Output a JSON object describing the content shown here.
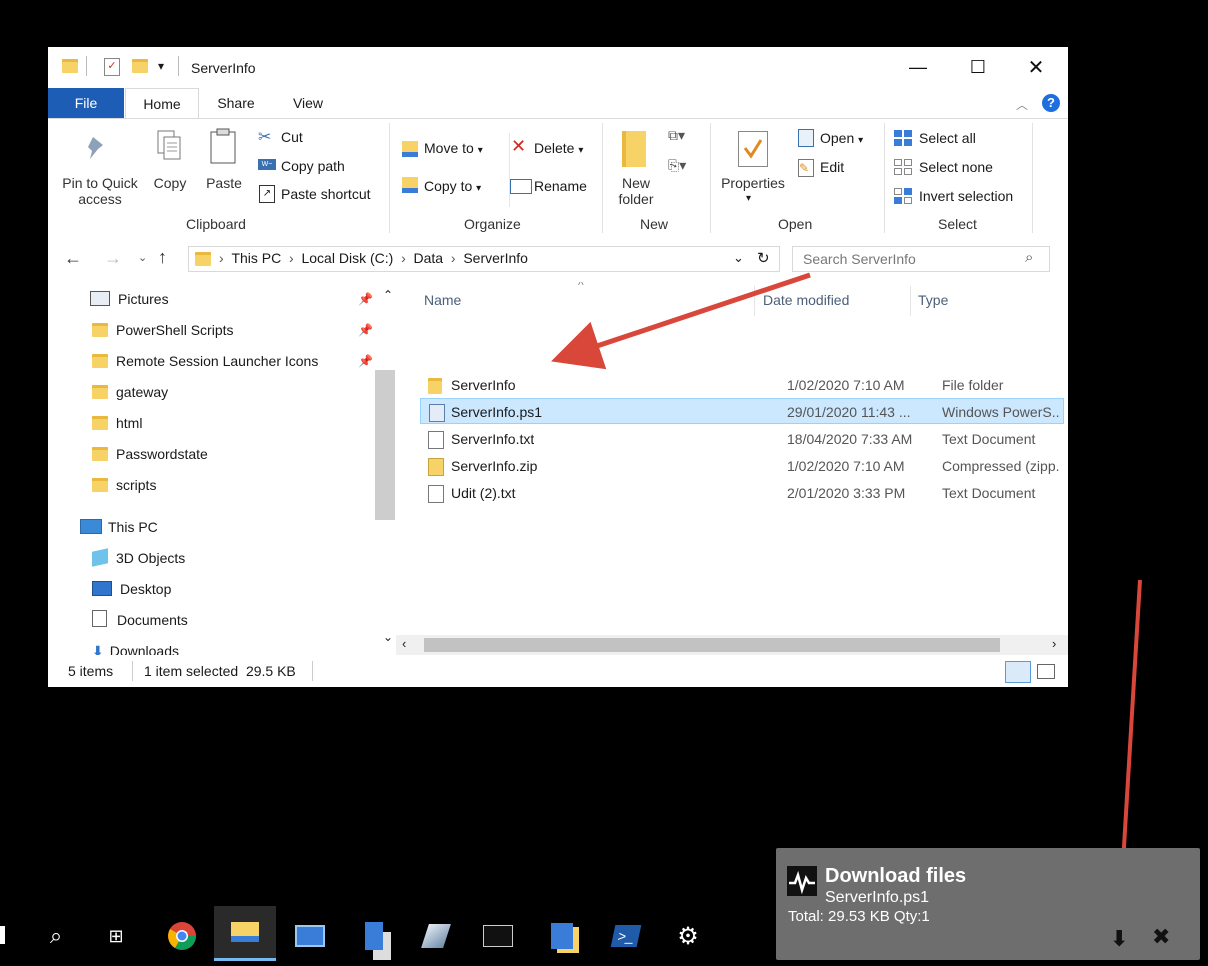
{
  "window": {
    "title": "ServerInfo",
    "tabs": [
      "File",
      "Home",
      "Share",
      "View"
    ]
  },
  "ribbon": {
    "clipboard": {
      "pin_label": "Pin to Quick access",
      "copy_label": "Copy",
      "paste_label": "Paste",
      "cut_label": "Cut",
      "copy_path_label": "Copy path",
      "paste_shortcut_label": "Paste shortcut",
      "group_label": "Clipboard"
    },
    "organize": {
      "move_to_label": "Move to",
      "delete_label": "Delete",
      "copy_to_label": "Copy to",
      "rename_label": "Rename",
      "group_label": "Organize"
    },
    "new": {
      "new_folder_label": "New folder",
      "group_label": "New"
    },
    "open": {
      "properties_label": "Properties",
      "open_label": "Open",
      "edit_label": "Edit",
      "group_label": "Open"
    },
    "select": {
      "select_all_label": "Select all",
      "select_none_label": "Select none",
      "invert_selection_label": "Invert selection",
      "group_label": "Select"
    }
  },
  "address": {
    "crumbs": [
      "This PC",
      "Local Disk (C:)",
      "Data",
      "ServerInfo"
    ],
    "search_placeholder": "Search ServerInfo"
  },
  "nav": {
    "items": [
      "Pictures",
      "PowerShell Scripts",
      "Remote Session Launcher Icons",
      "gateway",
      "html",
      "Passwordstate",
      "scripts",
      "This PC",
      "3D Objects",
      "Desktop",
      "Documents",
      "Downloads"
    ]
  },
  "content": {
    "columns": [
      "Name",
      "Date modified",
      "Type"
    ],
    "rows": [
      {
        "name": "ServerInfo",
        "date": "1/02/2020 7:10 AM",
        "type": "File folder"
      },
      {
        "name": "ServerInfo.ps1",
        "date": "29/01/2020 11:43 ...",
        "type": "Windows PowerS..."
      },
      {
        "name": "ServerInfo.txt",
        "date": "18/04/2020 7:33 AM",
        "type": "Text Document"
      },
      {
        "name": "ServerInfo.zip",
        "date": "1/02/2020 7:10 AM",
        "type": "Compressed (zipp..."
      },
      {
        "name": "Udit (2).txt",
        "date": "2/01/2020 3:33 PM",
        "type": "Text Document"
      }
    ]
  },
  "status": {
    "items_count": "5 items",
    "selection": "1 item selected  29.5 KB"
  },
  "toast": {
    "title": "Download files",
    "filename": "ServerInfo.ps1",
    "summary": "Total: 29.53 KB Qty:1"
  },
  "colors": {
    "file_tab": "#1e5db5",
    "selection": "#cce8ff",
    "arrow": "#d9473b",
    "toast_bg": "#6e6e6e"
  }
}
